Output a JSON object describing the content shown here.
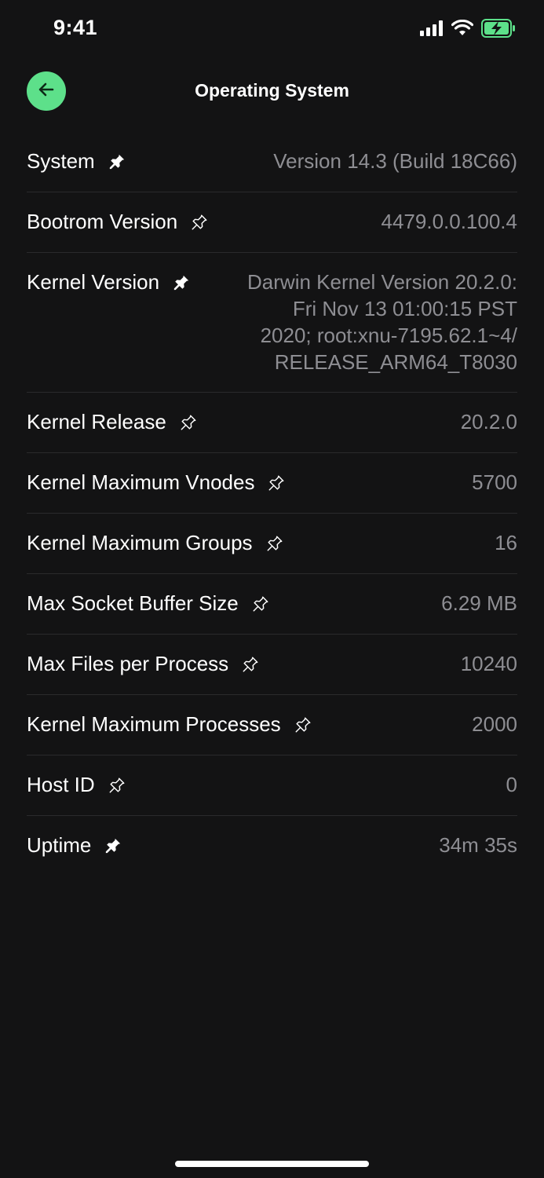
{
  "status_bar": {
    "time": "9:41",
    "icons": [
      "cellular-signal-icon",
      "wifi-icon",
      "battery-charging-icon"
    ],
    "battery_color": "#5de08a"
  },
  "header": {
    "title": "Operating System",
    "back_icon": "arrow-left-icon",
    "accent_color": "#5de08a"
  },
  "rows": [
    {
      "label": "System",
      "value": "Version 14.3 (Build 18C66)",
      "pinned": true
    },
    {
      "label": "Bootrom Version",
      "value": "4479.0.0.100.4",
      "pinned": false
    },
    {
      "label": "Kernel Version",
      "value": "Darwin Kernel Version 20.2.0: Fri Nov 13 01:00:15 PST 2020; root:xnu-7195.62.1~4/ RELEASE_ARM64_T8030",
      "pinned": true
    },
    {
      "label": "Kernel Release",
      "value": "20.2.0",
      "pinned": false
    },
    {
      "label": "Kernel Maximum Vnodes",
      "value": "5700",
      "pinned": false
    },
    {
      "label": "Kernel Maximum Groups",
      "value": "16",
      "pinned": false
    },
    {
      "label": "Max Socket Buffer Size",
      "value": "6.29 MB",
      "pinned": false
    },
    {
      "label": "Max Files per Process",
      "value": "10240",
      "pinned": false
    },
    {
      "label": "Kernel Maximum Processes",
      "value": "2000",
      "pinned": false
    },
    {
      "label": "Host ID",
      "value": "0",
      "pinned": false
    },
    {
      "label": "Uptime",
      "value": "34m 35s",
      "pinned": true
    }
  ]
}
